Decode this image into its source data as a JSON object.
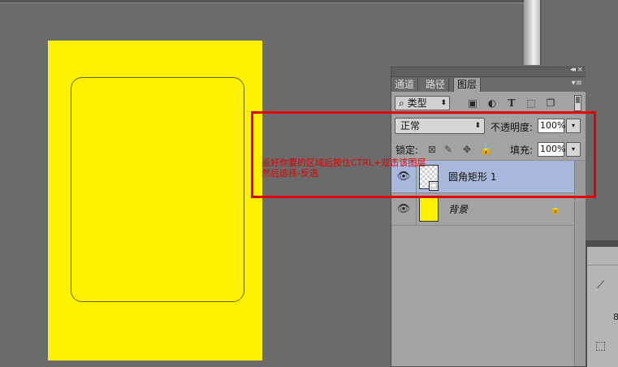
{
  "document": {
    "canvas_color": "#fff200",
    "shape": "rounded-rectangle"
  },
  "annotation": {
    "line1": "画好你要的区域后按住CTRL+双击该图层",
    "line2": "然后选择-反选",
    "color": "#e20000"
  },
  "layers_panel": {
    "tabs": [
      {
        "label": "通道",
        "active": false
      },
      {
        "label": "路径",
        "active": false
      },
      {
        "label": "图层",
        "active": true
      }
    ],
    "filter_kind": "类型",
    "filter_icons": [
      "image-filter-icon",
      "adjustment-filter-icon",
      "type-filter-icon",
      "shape-filter-icon",
      "smart-object-filter-icon"
    ],
    "blend_mode": "正常",
    "opacity_label": "不透明度:",
    "opacity_value": "100%",
    "lock_label": "锁定:",
    "fill_label": "填充:",
    "fill_value": "100%",
    "layers": [
      {
        "name": "圆角矩形 1",
        "selected": true,
        "visible": true,
        "thumb": "transparent"
      },
      {
        "name": "背景",
        "selected": false,
        "visible": true,
        "locked": true,
        "thumb": "yellow"
      }
    ]
  },
  "right_panel": {
    "value_text": "8"
  }
}
